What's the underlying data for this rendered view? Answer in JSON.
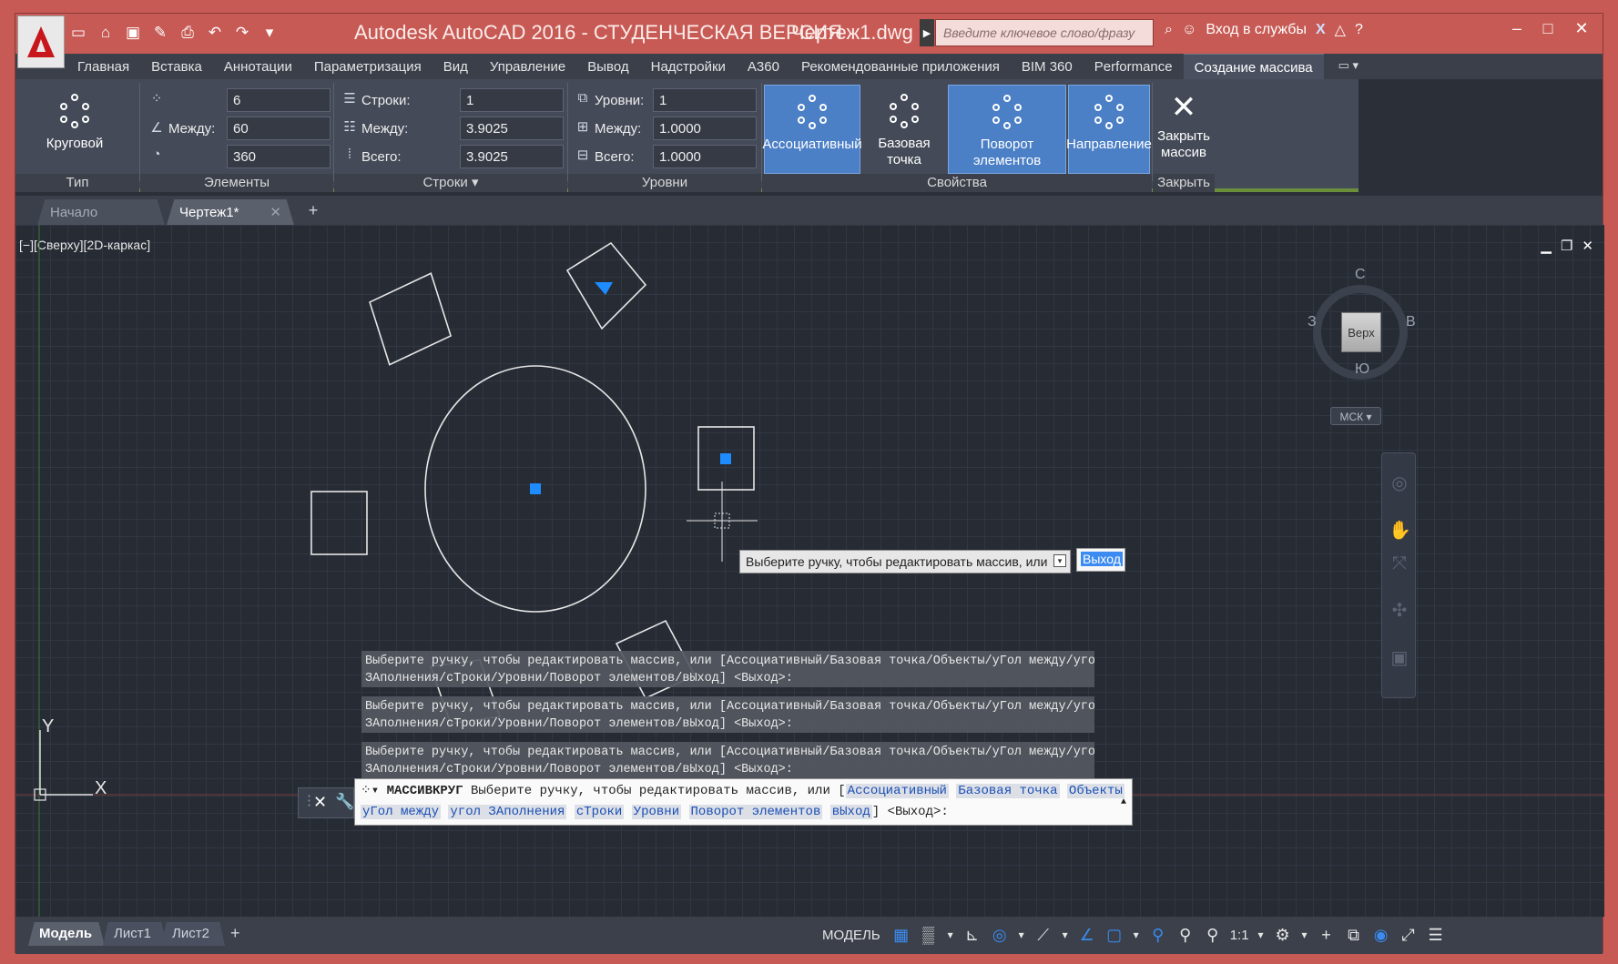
{
  "title_bar": {
    "app_title": "Autodesk AutoCAD 2016 - СТУДЕНЧЕСКАЯ ВЕРСИЯ",
    "file_name": "Чертеж1.dwg",
    "search_placeholder": "Введите ключевое слово/фразу",
    "sign_in": "Вход в службы",
    "quick_access_icons": [
      "new-icon",
      "open-icon",
      "save-icon",
      "save-as-icon",
      "print-icon",
      "undo-icon",
      "redo-icon",
      "customize-icon"
    ]
  },
  "ribbon_tabs": [
    "Главная",
    "Вставка",
    "Аннотации",
    "Параметризация",
    "Вид",
    "Управление",
    "Вывод",
    "Надстройки",
    "A360",
    "Рекомендованные приложения",
    "BIM 360",
    "Performance",
    "Создание массива"
  ],
  "active_ribbon_tab": "Создание массива",
  "ribbon": {
    "type_panel": {
      "title": "Тип",
      "button": "Круговой"
    },
    "items_panel": {
      "title": "Элементы",
      "count": "6",
      "between_label": "Между:",
      "between": "60",
      "fill": "360"
    },
    "rows_panel": {
      "title": "Строки",
      "rows_label": "Строки:",
      "rows": "1",
      "between_label": "Между:",
      "between": "3.9025",
      "total_label": "Всего:",
      "total": "3.9025"
    },
    "levels_panel": {
      "title": "Уровни",
      "levels_label": "Уровни:",
      "levels": "1",
      "between_label": "Между:",
      "between": "1.0000",
      "total_label": "Всего:",
      "total": "1.0000"
    },
    "properties_panel": {
      "title": "Свойства",
      "associative": "Ассоциативный",
      "base_point": "Базовая точка",
      "rotate_items": "Поворот элементов",
      "direction": "Направление"
    },
    "close_panel": {
      "title": "Закрыть",
      "close_line1": "Закрыть",
      "close_line2": "массив"
    }
  },
  "doc_tabs": [
    "Начало",
    "Чертеж1*"
  ],
  "viewport": {
    "label": "[−][Сверху][2D-каркас]",
    "viewcube": {
      "top": "Верх",
      "n": "С",
      "s": "Ю",
      "w": "З",
      "e": "В",
      "wcs": "МСК"
    },
    "ucs_x": "X",
    "ucs_y": "Y"
  },
  "tooltip": {
    "text": "Выберите ручку, чтобы редактировать массив, или",
    "default": "Выход"
  },
  "history": [
    {
      "l1": "Выберите ручку, чтобы редактировать массив, или [Ассоциативный/Базовая точка/Объекты/уГол между/угол",
      "l2": "ЗАполнения/сТроки/Уровни/Поворот элементов/вЫход] <Выход>:"
    },
    {
      "l1": "Выберите ручку, чтобы редактировать массив, или [Ассоциативный/Базовая точка/Объекты/уГол между/угол",
      "l2": "ЗАполнения/сТроки/Уровни/Поворот элементов/вЫход] <Выход>:"
    },
    {
      "l1": "Выберите ручку, чтобы редактировать массив, или [Ассоциативный/Базовая точка/Объекты/уГол между/угол",
      "l2": "ЗАполнения/сТроки/Уровни/Поворот элементов/вЫход] <Выход>:"
    }
  ],
  "command": {
    "name": "МАССИВКРУГ",
    "prompt": "Выберите ручку, чтобы редактировать массив, или [",
    "options": [
      "Ассоциативный",
      "Базовая точка",
      "Объекты",
      "уГол между",
      "угол ЗАполнения",
      "сТроки",
      "Уровни",
      "Поворот элементов",
      "вЫход"
    ],
    "suffix": "] <Выход>:"
  },
  "layout_tabs": [
    "Модель",
    "Лист1",
    "Лист2"
  ],
  "status_bar": {
    "mode": "МОДЕЛЬ",
    "scale": "1:1"
  },
  "colors": {
    "title_bar": "#c75a54",
    "accent_blue": "#4b7fc6",
    "grip_blue": "#1e8bff",
    "canvas": "#262b34"
  }
}
